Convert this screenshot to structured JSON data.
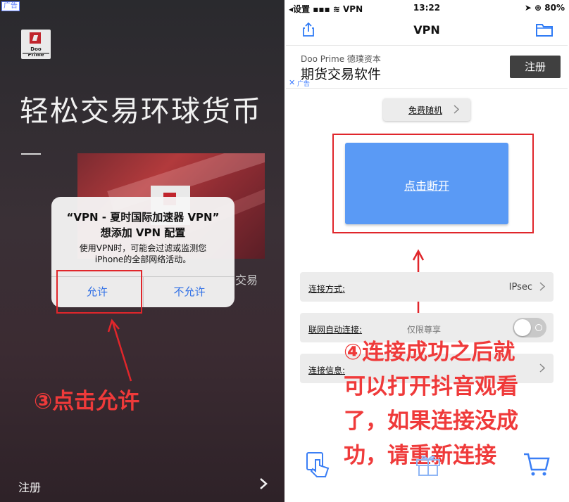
{
  "left": {
    "ad_tag": "广告",
    "logo": {
      "brand": "Doo Prime"
    },
    "hero_text": "轻松交易环球货币",
    "side_text": "交易",
    "alert": {
      "title_line1": "“VPN - 夏时国际加速器 VPN”",
      "title_line2": "想添加 VPN 配置",
      "message_line1": "使用VPN时，可能会过滤或监测您",
      "message_line2": "iPhone的全部网络活动。",
      "allow": "允许",
      "deny": "不允许"
    },
    "step3_caption": "③点击允许",
    "register": "注册"
  },
  "right": {
    "status": {
      "left": "◂设置 ▪▪▪ ≋ VPN",
      "time": "13:22",
      "right": "➤ ⊕ 80%"
    },
    "nav_title": "VPN",
    "ad": {
      "brand": "Doo Prime 德璞资本",
      "headline": "期货交易软件",
      "register": "注册",
      "close": "✕",
      "label": "广告"
    },
    "free_button": "免费随机",
    "disconnect": "点击断开",
    "rows": [
      {
        "label": "连接方式:",
        "value": "IPsec"
      },
      {
        "label": "联网自动连接:",
        "sub": "仅限尊享"
      },
      {
        "label": "连接信息:"
      }
    ],
    "step4_caption": "④连接成功之后就可以打开抖音观看了，如果连接没成功，请重新连接",
    "tabs": [
      "hand-tap-icon",
      "gift-icon",
      "cart-icon"
    ]
  },
  "colors": {
    "accent_blue": "#5a9af5",
    "annotation_red": "#ef3a3a",
    "ios_blue": "#2f6fe6",
    "brand_red": "#c0242c"
  }
}
